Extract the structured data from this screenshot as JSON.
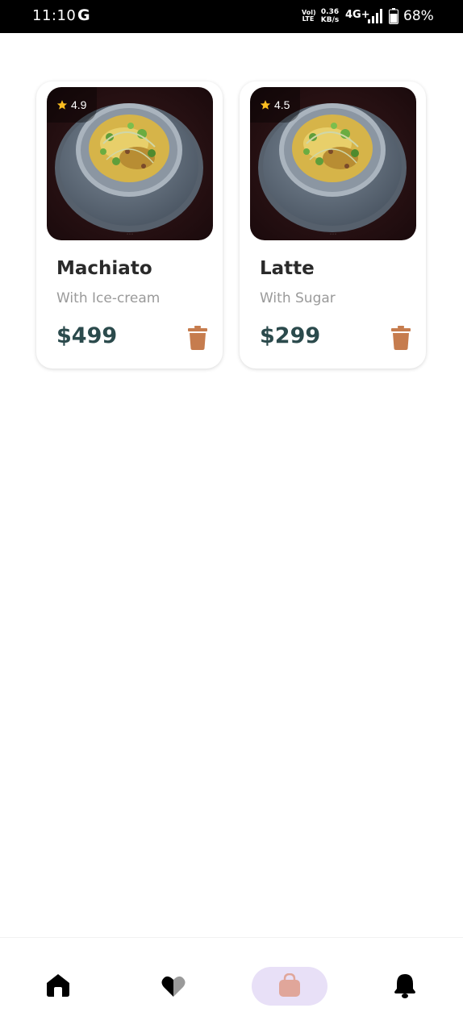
{
  "status_bar": {
    "time": "11:10",
    "google_icon_letter": "G",
    "volte_line1": "Vol)",
    "volte_line2": "LTE",
    "speed_value": "0.36",
    "speed_unit": "KB/s",
    "network": "4G+",
    "battery_percent": "68%"
  },
  "cart_items": [
    {
      "rating": "4.9",
      "title": "Machiato",
      "subtitle": "With Ice-cream",
      "price": "$499",
      "image": "pasta-bowl-image"
    },
    {
      "rating": "4.5",
      "title": "Latte",
      "subtitle": "With Sugar",
      "price": "$299",
      "image": "pasta-bowl-image"
    }
  ],
  "bottom_nav": {
    "items": [
      "home-icon",
      "heart-icon",
      "shopping-bag-icon",
      "bell-icon"
    ],
    "active": "shopping-bag-icon"
  },
  "colors": {
    "accent": "#c67c4e",
    "price": "#2b4a4c",
    "active_nav_bg": "#e8e0f7",
    "rating_star": "#fbbe21"
  }
}
